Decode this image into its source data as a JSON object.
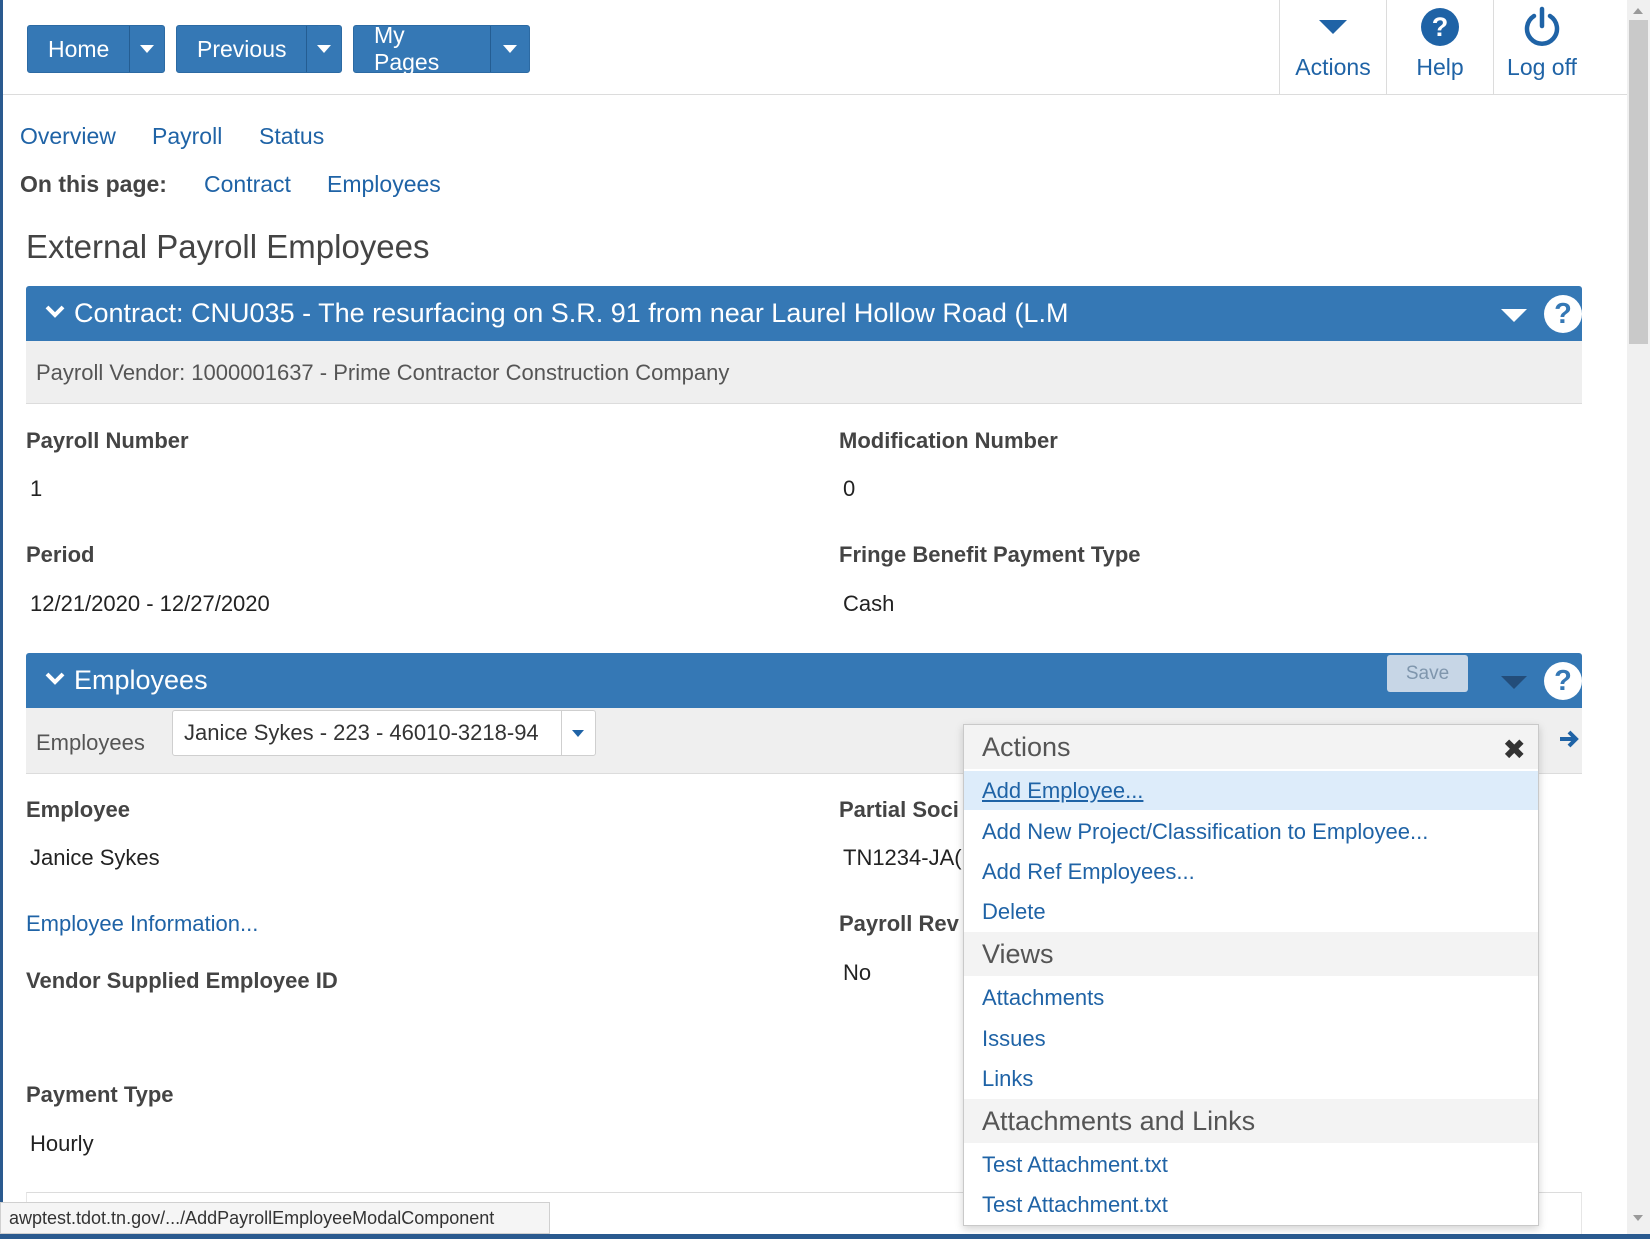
{
  "nav": {
    "home_label": "Home",
    "previous_label": "Previous",
    "mypages_label": "My Pages",
    "actions_label": "Actions",
    "help_label": "Help",
    "logoff_label": "Log off"
  },
  "tabs": [
    "Overview",
    "Payroll",
    "Status"
  ],
  "on_this_page": {
    "label": "On this page:",
    "links": [
      "Contract",
      "Employees"
    ]
  },
  "page_title": "External Payroll Employees",
  "contract_panel": {
    "header": "Contract: CNU035 - The resurfacing on S.R. 91 from near Laurel Hollow Road (L.M",
    "vendor": "Payroll Vendor: 1000001637 - Prime Contractor Construction Company"
  },
  "fields": {
    "payroll_number_label": "Payroll Number",
    "payroll_number_value": "1",
    "modification_number_label": "Modification Number",
    "modification_number_value": "0",
    "period_label": "Period",
    "period_value": "12/21/2020 - 12/27/2020",
    "fringe_label": "Fringe Benefit Payment Type",
    "fringe_value": "Cash"
  },
  "employees_panel": {
    "header": "Employees",
    "save_label": "Save",
    "select_label": "Employees",
    "select_value": "Janice Sykes - 223 - 46010-3218-94",
    "employee_label": "Employee",
    "employee_value": "Janice Sykes",
    "partial_ssn_label": "Partial Soci",
    "partial_ssn_value": "TN1234-JA(",
    "employee_info_link": "Employee Information...",
    "payroll_rev_label": "Payroll Rev",
    "payroll_rev_value": "No",
    "vendor_id_label": "Vendor Supplied Employee ID",
    "payment_type_label": "Payment Type",
    "payment_type_value": "Hourly"
  },
  "actions_menu": {
    "title": "Actions",
    "items": [
      "Add Employee...",
      "Add New Project/Classification to Employee...",
      "Add Ref Employees...",
      "Delete"
    ],
    "views_title": "Views",
    "views": [
      "Attachments",
      "Issues",
      "Links"
    ],
    "attachments_title": "Attachments and Links",
    "attachments": [
      "Test Attachment.txt",
      "Test Attachment.txt"
    ]
  },
  "status_bar_url": "awptest.tdot.tn.gov/.../AddPayrollEmployeeModalComponent",
  "colors": {
    "primary": "#3578b5",
    "link": "#1f63a6",
    "highlight": "#ddecfa"
  }
}
